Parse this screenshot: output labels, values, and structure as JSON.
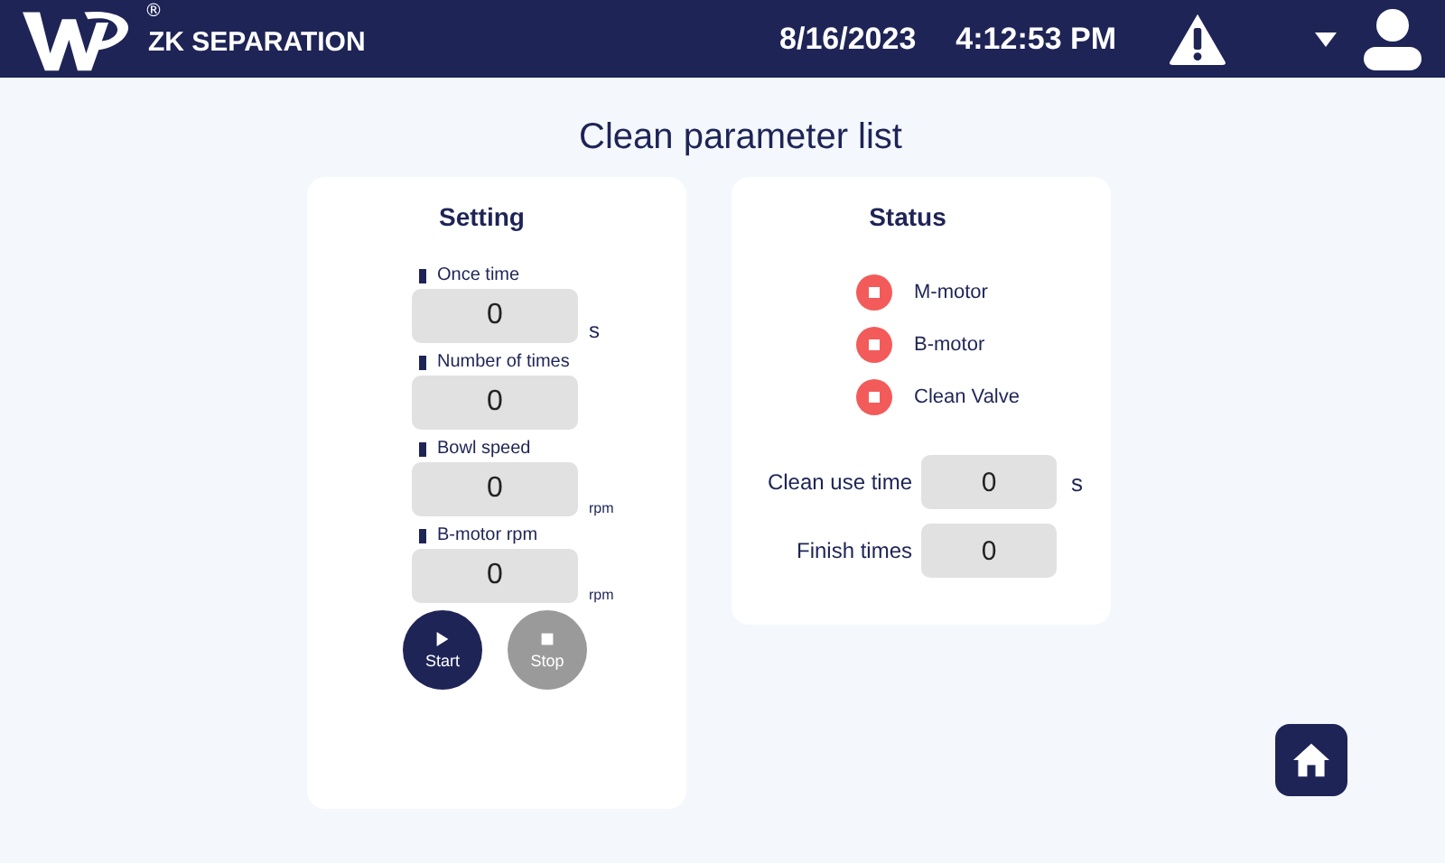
{
  "header": {
    "brand": "ZK SEPARATION",
    "logo_mark": "®",
    "date": "8/16/2023",
    "time": "4:12:53 PM"
  },
  "title": "Clean parameter list",
  "setting": {
    "heading": "Setting",
    "fields": [
      {
        "label": "Once time",
        "value": "0",
        "unit": "s",
        "kind": "seconds"
      },
      {
        "label": "Number of times",
        "value": "0",
        "kind": "count"
      },
      {
        "label": "Bowl speed",
        "value": "0",
        "unit": "rpm",
        "kind": "speed"
      },
      {
        "label": "B-motor rpm",
        "value": "0",
        "unit": "rpm",
        "kind": "speed"
      }
    ],
    "buttons": [
      {
        "label": "Start",
        "kind": "play",
        "disabled": false
      },
      {
        "label": "Stop",
        "kind": "stop",
        "disabled": true
      }
    ]
  },
  "status": {
    "heading": "Status",
    "lamps": [
      {
        "label": "M-motor",
        "on": false
      },
      {
        "label": "B-motor",
        "on": false
      },
      {
        "label": "Clean Valve",
        "on": false
      }
    ],
    "readings": [
      {
        "label": "Clean use time",
        "value": "0",
        "unit": "s"
      },
      {
        "label": "Finish times",
        "value": "0"
      }
    ]
  }
}
